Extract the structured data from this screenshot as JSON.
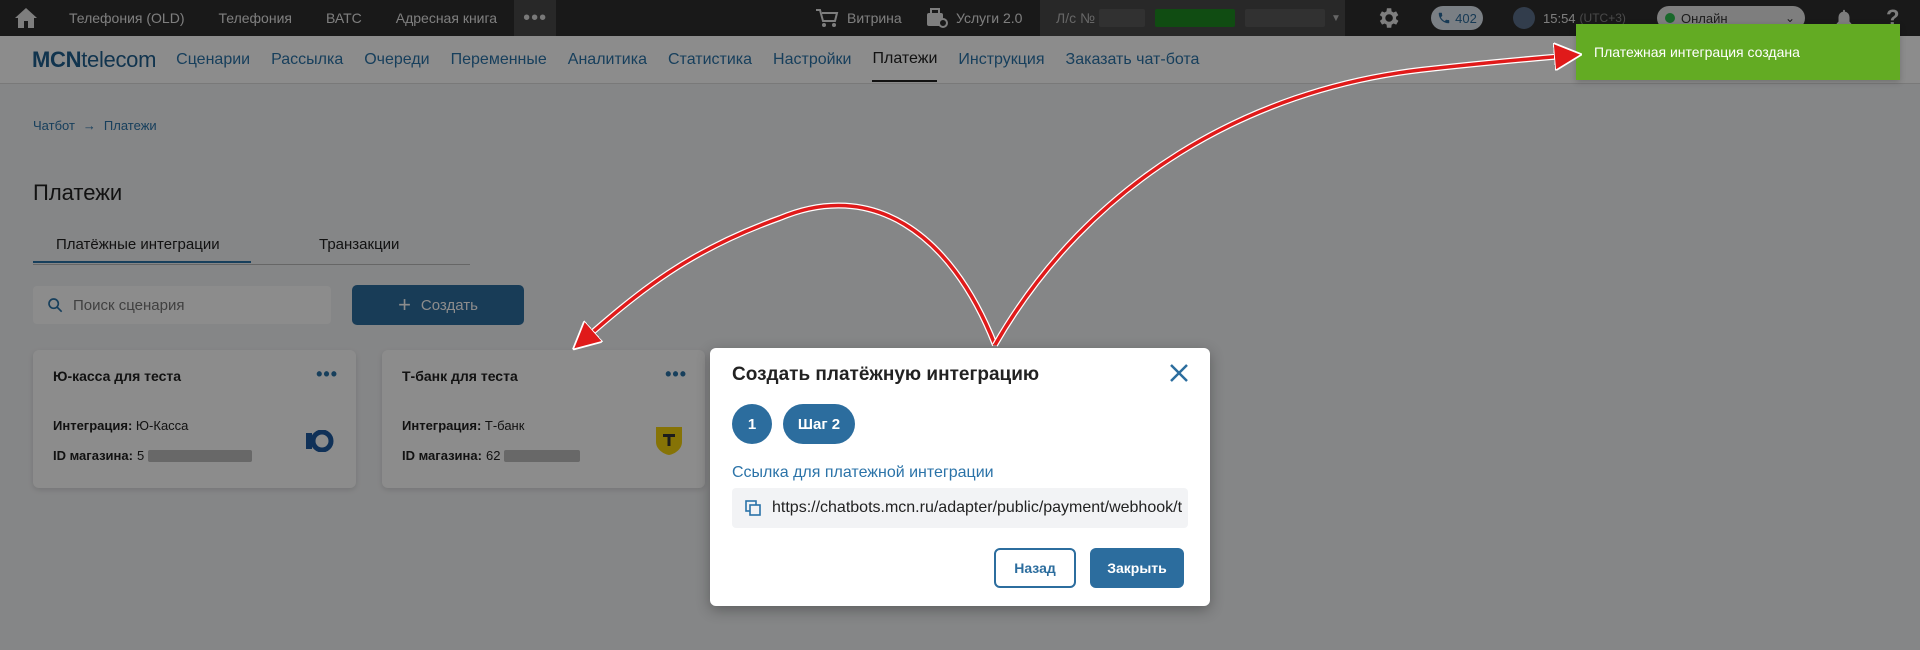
{
  "topbar": {
    "nav": [
      "Телефония (OLD)",
      "Телефония",
      "ВАТС",
      "Адресная книга"
    ],
    "more": "•••",
    "showcase": "Витрина",
    "services": "Услуги 2.0",
    "account_label": "Л/с №",
    "phone_count": "402",
    "time": "15:54",
    "tz": "(UTC+3)",
    "status": "Онлайн"
  },
  "navbar": {
    "logo_bold": "MCN",
    "logo_rest": "telecom",
    "items": [
      "Сценарии",
      "Рассылка",
      "Очереди",
      "Переменные",
      "Аналитика",
      "Статистика",
      "Настройки",
      "Платежи",
      "Инструкция",
      "Заказать чат-бота"
    ],
    "active_index": 7
  },
  "breadcrumb": {
    "root": "Чатбот",
    "current": "Платежи"
  },
  "page_title": "Платежи",
  "tabs": [
    "Платёжные интеграции",
    "Транзакции"
  ],
  "search": {
    "placeholder": "Поиск сценария"
  },
  "create_button": "Создать",
  "cards": [
    {
      "title": "Ю-касса для теста",
      "integration_label": "Интеграция:",
      "integration_value": "Ю-Касса",
      "shop_label": "ID магазина:",
      "shop_value": "5"
    },
    {
      "title": "Т-банк для теста",
      "integration_label": "Интеграция:",
      "integration_value": "Т-банк",
      "shop_label": "ID магазина:",
      "shop_value": "62"
    }
  ],
  "modal": {
    "title": "Создать платёжную интеграцию",
    "step1": "1",
    "step2": "Шаг 2",
    "link_label": "Ссылка для платежной интеграции",
    "link_value": "https://chatbots.mcn.ru/adapter/public/payment/webhook/t",
    "back": "Назад",
    "close": "Закрыть"
  },
  "toast": "Платежная интеграция создана",
  "colors": {
    "primary": "#2c6d9e",
    "link": "#2b73a8",
    "toast": "#63ab23",
    "topbar": "#2f2f2f"
  }
}
